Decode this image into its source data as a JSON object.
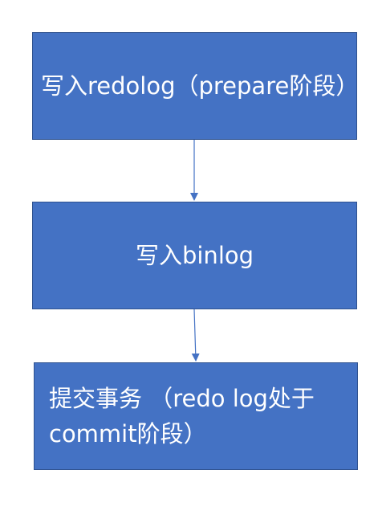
{
  "steps": [
    {
      "id": "step-1",
      "label": "写入redolog（prepare阶段）"
    },
    {
      "id": "step-2",
      "label": "写入binlog"
    },
    {
      "id": "step-3",
      "label": "提交事务 （redo log处于commit阶段）"
    }
  ],
  "colors": {
    "box_fill": "#4472c4",
    "box_border": "#2f528f",
    "text": "#ffffff",
    "arrow": "#4472c4"
  }
}
